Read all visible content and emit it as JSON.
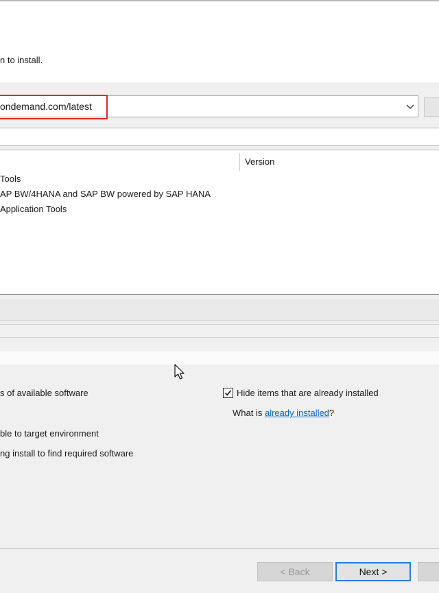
{
  "header": {
    "description": "n to install."
  },
  "site_selector": {
    "url_value": "ondemand.com/latest"
  },
  "table": {
    "version_header": "Version",
    "rows": [
      "Tools",
      "AP BW/4HANA and SAP BW powered by SAP HANA",
      "Application Tools"
    ]
  },
  "options": {
    "show_latest": "s of available software",
    "group_items": "ble to target environment",
    "contact_sites": "ng install to find required software",
    "hide_installed": "Hide items that are already installed",
    "hide_installed_checked": true,
    "what_is_prefix": "What is ",
    "what_is_link": "already installed",
    "what_is_suffix": "?"
  },
  "buttons": {
    "back": "< Back",
    "next": "Next >"
  },
  "colors": {
    "highlight": "#e0282e",
    "link": "#0066cc",
    "default_button_border": "#2c7ad6"
  }
}
